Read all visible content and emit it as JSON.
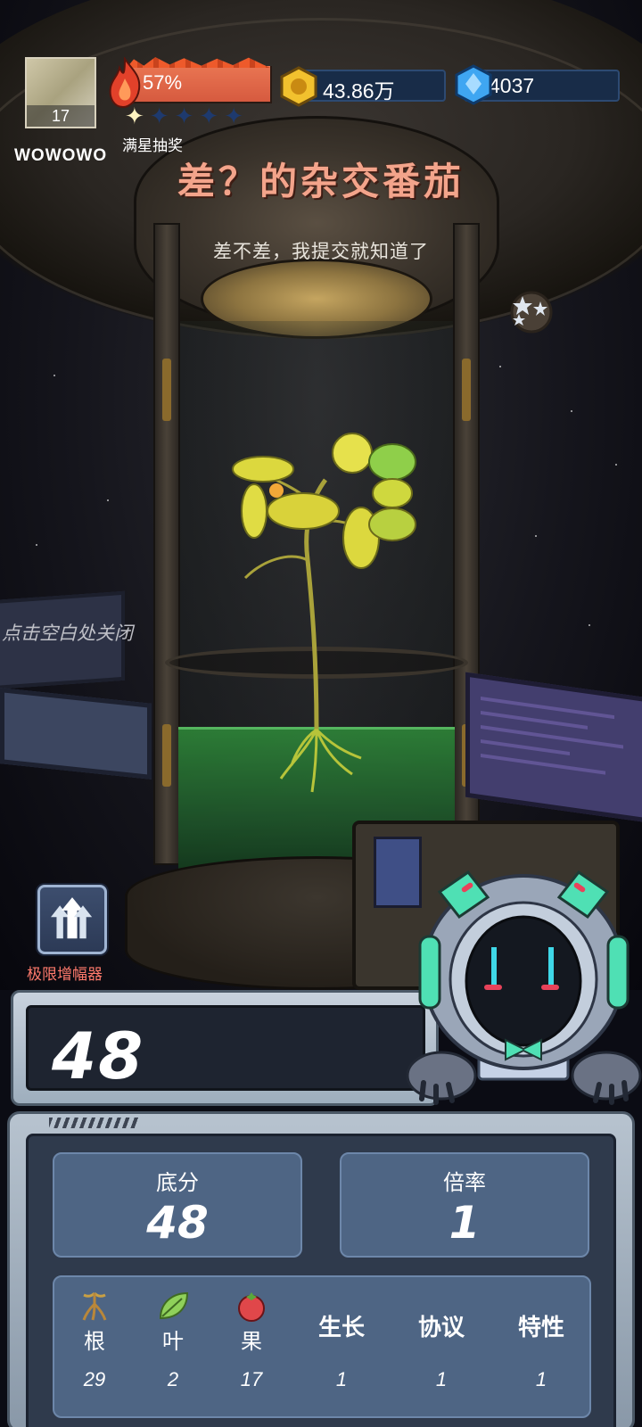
{
  "player": {
    "name": "WOWOWO",
    "level": "17"
  },
  "hud": {
    "heat_percent": "57%",
    "stars_filled": 1,
    "stars_total": 5,
    "lottery_label": "满星抽奖",
    "gold": "43.86万",
    "diamonds": "4037"
  },
  "result": {
    "title": "差？的杂交番茄",
    "subtitle": "差不差，我提交就知道了"
  },
  "hints": {
    "close_hint": "点击空白处关闭",
    "amplifier_label": "极限增幅器"
  },
  "score": {
    "total": "48",
    "base_label": "底分",
    "base_value": "48",
    "rate_label": "倍率",
    "rate_value": "1"
  },
  "attributes": [
    {
      "icon": "root-icon",
      "label": "根",
      "value": "29"
    },
    {
      "icon": "leaf-icon",
      "label": "叶",
      "value": "2"
    },
    {
      "icon": "fruit-icon",
      "label": "果",
      "value": "17"
    },
    {
      "icon": "",
      "label": "生长",
      "value": "1"
    },
    {
      "icon": "",
      "label": "协议",
      "value": "1"
    },
    {
      "icon": "",
      "label": "特性",
      "value": "1"
    }
  ],
  "colors": {
    "title": "#f3a48b",
    "heat_bar": "#e06546",
    "amplifier_label": "#ff7a6c",
    "panel_card": "#4e6584",
    "liquid": "#2f8c3a"
  }
}
